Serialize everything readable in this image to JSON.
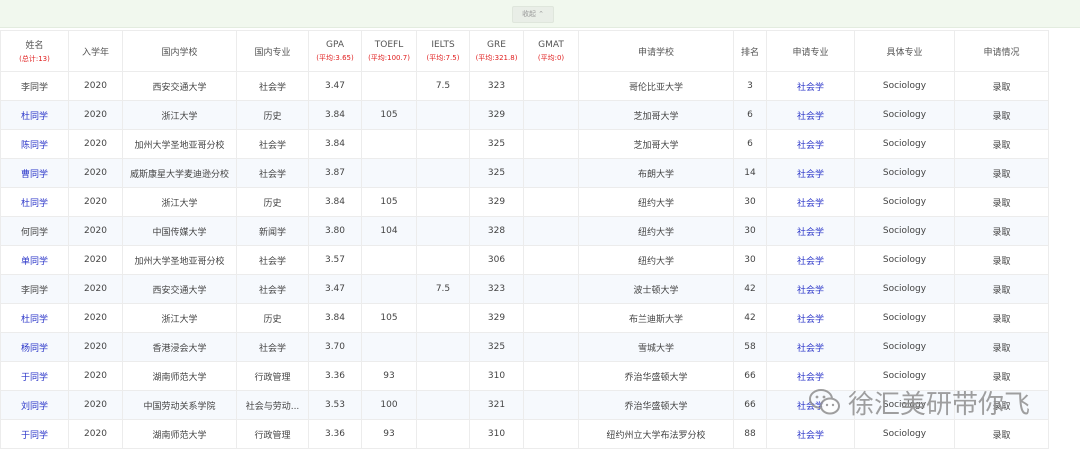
{
  "toolbar": {
    "collapse_label": "收起",
    "collapse_icon": "chevron-double-up-icon"
  },
  "columns": [
    {
      "label": "姓名",
      "avg": "(总计:13)"
    },
    {
      "label": "入学年",
      "avg": ""
    },
    {
      "label": "国内学校",
      "avg": ""
    },
    {
      "label": "国内专业",
      "avg": ""
    },
    {
      "label": "GPA",
      "avg": "(平均:3.65)"
    },
    {
      "label": "TOEFL",
      "avg": "(平均:100.7)"
    },
    {
      "label": "IELTS",
      "avg": "(平均:7.5)"
    },
    {
      "label": "GRE",
      "avg": "(平均:321.8)"
    },
    {
      "label": "GMAT",
      "avg": "(平均:0)"
    },
    {
      "label": "申请学校",
      "avg": ""
    },
    {
      "label": "排名",
      "avg": ""
    },
    {
      "label": "申请专业",
      "avg": ""
    },
    {
      "label": "具体专业",
      "avg": ""
    },
    {
      "label": "申请情况",
      "avg": ""
    }
  ],
  "rows": [
    {
      "name": "李同学",
      "name_link": false,
      "year": "2020",
      "school": "西安交通大学",
      "major": "社会学",
      "gpa": "3.47",
      "toefl": "",
      "ielts": "7.5",
      "gre": "323",
      "gmat": "",
      "target": "哥伦比亚大学",
      "rank": "3",
      "apply_major": "社会学",
      "specific": "Sociology",
      "result": "录取"
    },
    {
      "name": "杜同学",
      "name_link": true,
      "year": "2020",
      "school": "浙江大学",
      "major": "历史",
      "gpa": "3.84",
      "toefl": "105",
      "ielts": "",
      "gre": "329",
      "gmat": "",
      "target": "芝加哥大学",
      "rank": "6",
      "apply_major": "社会学",
      "specific": "Sociology",
      "result": "录取"
    },
    {
      "name": "陈同学",
      "name_link": true,
      "year": "2020",
      "school": "加州大学圣地亚哥分校",
      "major": "社会学",
      "gpa": "3.84",
      "toefl": "",
      "ielts": "",
      "gre": "325",
      "gmat": "",
      "target": "芝加哥大学",
      "rank": "6",
      "apply_major": "社会学",
      "specific": "Sociology",
      "result": "录取"
    },
    {
      "name": "曹同学",
      "name_link": true,
      "year": "2020",
      "school": "威斯康星大学麦迪逊分校",
      "major": "社会学",
      "gpa": "3.87",
      "toefl": "",
      "ielts": "",
      "gre": "325",
      "gmat": "",
      "target": "布朗大学",
      "rank": "14",
      "apply_major": "社会学",
      "specific": "Sociology",
      "result": "录取"
    },
    {
      "name": "杜同学",
      "name_link": true,
      "year": "2020",
      "school": "浙江大学",
      "major": "历史",
      "gpa": "3.84",
      "toefl": "105",
      "ielts": "",
      "gre": "329",
      "gmat": "",
      "target": "纽约大学",
      "rank": "30",
      "apply_major": "社会学",
      "specific": "Sociology",
      "result": "录取"
    },
    {
      "name": "何同学",
      "name_link": false,
      "year": "2020",
      "school": "中国传媒大学",
      "major": "新闻学",
      "gpa": "3.80",
      "toefl": "104",
      "ielts": "",
      "gre": "328",
      "gmat": "",
      "target": "纽约大学",
      "rank": "30",
      "apply_major": "社会学",
      "specific": "Sociology",
      "result": "录取"
    },
    {
      "name": "单同学",
      "name_link": true,
      "year": "2020",
      "school": "加州大学圣地亚哥分校",
      "major": "社会学",
      "gpa": "3.57",
      "toefl": "",
      "ielts": "",
      "gre": "306",
      "gmat": "",
      "target": "纽约大学",
      "rank": "30",
      "apply_major": "社会学",
      "specific": "Sociology",
      "result": "录取"
    },
    {
      "name": "李同学",
      "name_link": false,
      "year": "2020",
      "school": "西安交通大学",
      "major": "社会学",
      "gpa": "3.47",
      "toefl": "",
      "ielts": "7.5",
      "gre": "323",
      "gmat": "",
      "target": "波士顿大学",
      "rank": "42",
      "apply_major": "社会学",
      "specific": "Sociology",
      "result": "录取"
    },
    {
      "name": "杜同学",
      "name_link": true,
      "year": "2020",
      "school": "浙江大学",
      "major": "历史",
      "gpa": "3.84",
      "toefl": "105",
      "ielts": "",
      "gre": "329",
      "gmat": "",
      "target": "布兰迪斯大学",
      "rank": "42",
      "apply_major": "社会学",
      "specific": "Sociology",
      "result": "录取"
    },
    {
      "name": "杨同学",
      "name_link": true,
      "year": "2020",
      "school": "香港浸会大学",
      "major": "社会学",
      "gpa": "3.70",
      "toefl": "",
      "ielts": "",
      "gre": "325",
      "gmat": "",
      "target": "雪城大学",
      "rank": "58",
      "apply_major": "社会学",
      "specific": "Sociology",
      "result": "录取"
    },
    {
      "name": "于同学",
      "name_link": true,
      "year": "2020",
      "school": "湖南师范大学",
      "major": "行政管理",
      "gpa": "3.36",
      "toefl": "93",
      "ielts": "",
      "gre": "310",
      "gmat": "",
      "target": "乔治华盛顿大学",
      "rank": "66",
      "apply_major": "社会学",
      "specific": "Sociology",
      "result": "录取"
    },
    {
      "name": "刘同学",
      "name_link": true,
      "year": "2020",
      "school": "中国劳动关系学院",
      "major": "社会与劳动...",
      "gpa": "3.53",
      "toefl": "100",
      "ielts": "",
      "gre": "321",
      "gmat": "",
      "target": "乔治华盛顿大学",
      "rank": "66",
      "apply_major": "社会学",
      "specific": "Sociology",
      "result": "录取"
    },
    {
      "name": "于同学",
      "name_link": true,
      "year": "2020",
      "school": "湖南师范大学",
      "major": "行政管理",
      "gpa": "3.36",
      "toefl": "93",
      "ielts": "",
      "gre": "310",
      "gmat": "",
      "target": "纽约州立大学布法罗分校",
      "rank": "88",
      "apply_major": "社会学",
      "specific": "Sociology",
      "result": "录取"
    }
  ],
  "watermark": {
    "text": "徐汇美研带你飞",
    "icon": "wechat-icon"
  },
  "colors": {
    "link": "#2b36c9",
    "avg": "#e01f1f",
    "topbar": "#f1f8ee",
    "row_alt": "#f6f9fd"
  }
}
